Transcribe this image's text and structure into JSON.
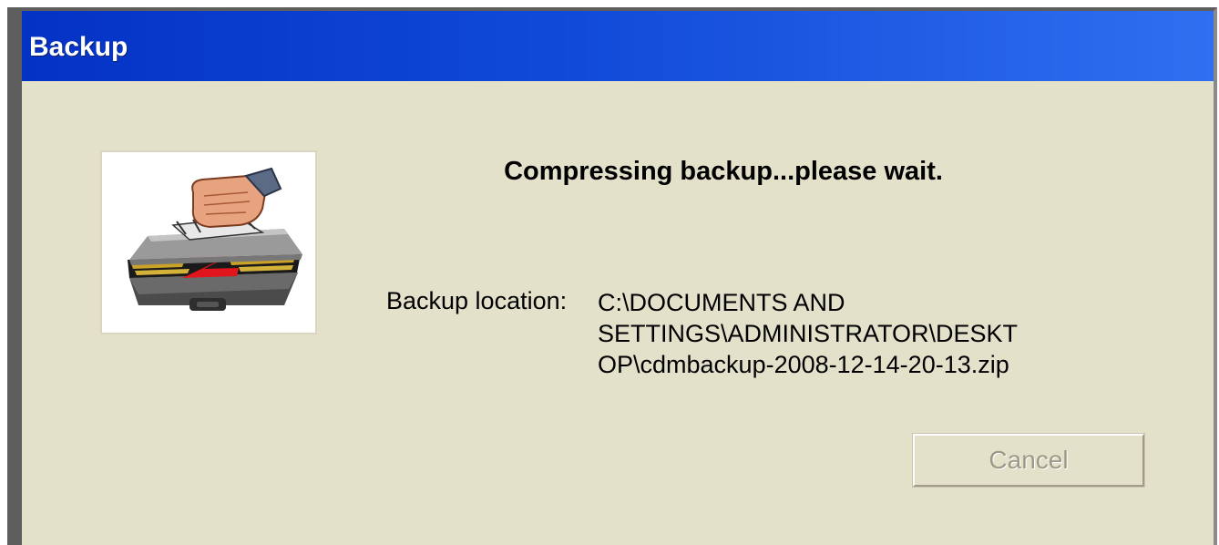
{
  "window": {
    "title": "Backup"
  },
  "icon": {
    "name": "backup-briefcase-icon"
  },
  "status": {
    "message": "Compressing backup...please wait."
  },
  "location": {
    "label": "Backup location:",
    "path_lines": [
      "C:\\DOCUMENTS AND",
      "SETTINGS\\ADMINISTRATOR\\DESKT",
      "OP\\cdmbackup-2008-12-14-20-13.zip"
    ]
  },
  "buttons": {
    "cancel_label": "Cancel",
    "cancel_enabled": false
  },
  "colors": {
    "titlebar_start": "#0432c4",
    "titlebar_end": "#2f6ff0",
    "dialog_bg": "#e4e1cb",
    "disabled_text": "#9e9a88"
  }
}
